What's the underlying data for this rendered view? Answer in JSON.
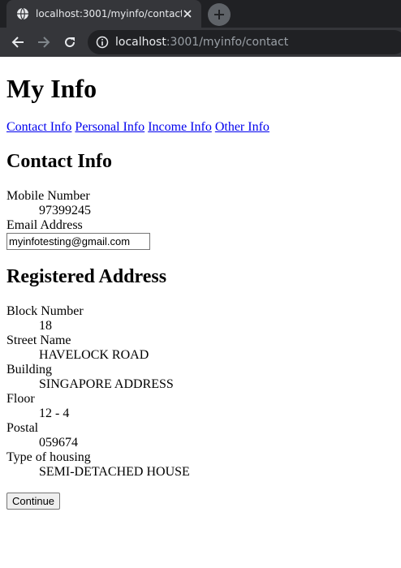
{
  "browser": {
    "tab_title": "localhost:3001/myinfo/contact",
    "url_host": "localhost",
    "url_rest": ":3001/myinfo/contact"
  },
  "page": {
    "title": "My Info",
    "nav": [
      "Contact Info",
      "Personal Info",
      "Income Info",
      "Other Info"
    ],
    "contact": {
      "heading": "Contact Info",
      "mobile_label": "Mobile Number",
      "mobile_value": "97399245",
      "email_label": "Email Address",
      "email_value": "myinfotesting@gmail.com"
    },
    "address": {
      "heading": "Registered Address",
      "fields": [
        {
          "label": "Block Number",
          "value": "18"
        },
        {
          "label": "Street Name",
          "value": "HAVELOCK ROAD"
        },
        {
          "label": "Building",
          "value": "SINGAPORE ADDRESS"
        },
        {
          "label": "Floor",
          "value": "12 - 4"
        },
        {
          "label": "Postal",
          "value": "059674"
        },
        {
          "label": "Type of housing",
          "value": "SEMI-DETACHED HOUSE"
        }
      ]
    },
    "continue_label": "Continue"
  }
}
